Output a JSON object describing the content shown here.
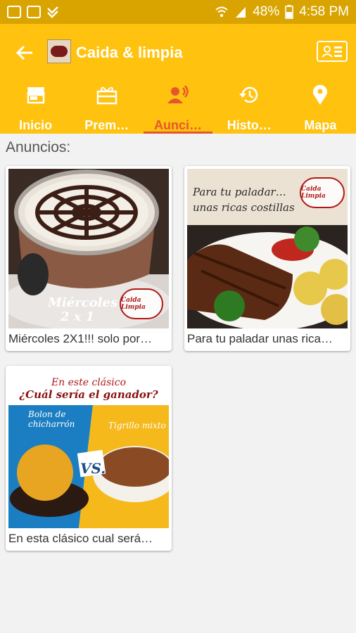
{
  "status_bar": {
    "battery": "48%",
    "time": "4:58 PM",
    "icons": [
      "image-icon",
      "gallery-icon",
      "check-notification-icon",
      "wifi-icon",
      "signal-icon",
      "battery-icon"
    ]
  },
  "app_bar": {
    "title": "Caida & limpia",
    "back_icon": "arrow-back-icon",
    "profile_icon": "contact-card-icon",
    "logo_text": "Caida Limpia",
    "colors": {
      "background": "#ffc20e",
      "active": "#e4572e",
      "text": "#ffffff"
    }
  },
  "tabs": [
    {
      "label": "Inicio",
      "icon": "store-icon"
    },
    {
      "label": "Prem…",
      "icon": "gift-icon"
    },
    {
      "label": "Aunci…",
      "icon": "speaker-icon",
      "active": true
    },
    {
      "label": "Histo…",
      "icon": "history-icon"
    },
    {
      "label": "Mapa",
      "icon": "location-pin-icon"
    }
  ],
  "section": {
    "title": "Anuncios:"
  },
  "ads": [
    {
      "caption": "Miércoles 2X1!!! solo por…",
      "image_text": [
        "Miércoles",
        "2 x 1"
      ],
      "badge": "Caida Limpia"
    },
    {
      "caption": "Para tu paladar unas rica…",
      "image_text": [
        "Para tu paladar…",
        "unas ricas costillas"
      ],
      "badge": "Caida Limpia"
    },
    {
      "caption": "En esta clásico cual será…",
      "image_text": [
        "En este clásico",
        "¿Cuál sería el ganador?",
        "Bolon de chicharrón",
        "Tigrillo mixto",
        "VS."
      ]
    }
  ]
}
